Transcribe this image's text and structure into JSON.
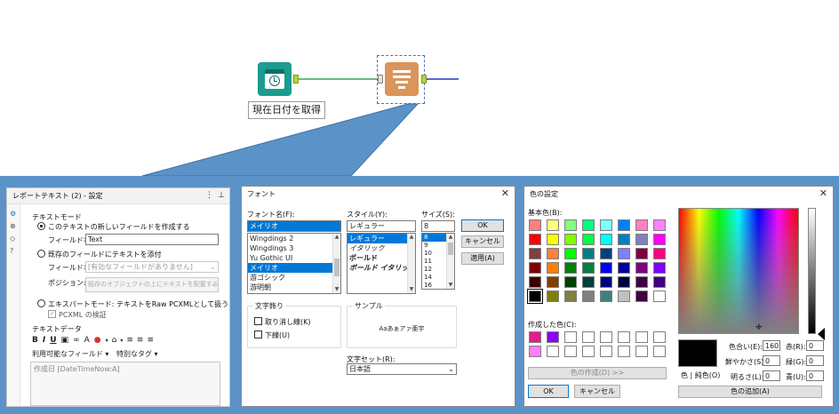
{
  "canvas": {
    "date_tool_label": "現在日付を取得"
  },
  "config": {
    "title": "レポートテキスト (2) - 設定",
    "text_mode_label": "テキストモード",
    "radio_new_field": "このテキストの新しいフィールドを作成する",
    "field_name_label": "フィールド名:",
    "field_name_value": "Text",
    "radio_append": "既存のフィールドにテキストを添付",
    "field_name_label2": "フィールド名:",
    "field_name_placeholder": "[有効なフィールドがありません]",
    "position_label": "ポジション:",
    "position_value": "既存のオブジェクトの上にテキストを配置する",
    "radio_expert": "エキスパートモード: テキストをRaw PCXMLとして扱う",
    "pcxml_validate": "PCXML の検証",
    "text_data_label": "テキストデータ",
    "available_fields": "利用可能なフィールド",
    "special_tags": "特別なタグ",
    "text_content": "作成日 [DateTimeNow:A]"
  },
  "font_dialog": {
    "title": "フォント",
    "font_name_label": "フォント名(F):",
    "font_name_value": "メイリオ",
    "font_list": [
      "Wingdings 2",
      "Wingdings 3",
      "Yu Gothic UI",
      "メイリオ",
      "游ゴシック",
      "游明朝"
    ],
    "style_label": "スタイル(Y):",
    "style_value": "レギュラー",
    "style_list": [
      "レギュラー",
      "イタリック",
      "ボールド",
      "ボールド イタリック"
    ],
    "size_label": "サイズ(S):",
    "size_value": "8",
    "size_list": [
      "8",
      "9",
      "10",
      "11",
      "12",
      "14",
      "16"
    ],
    "ok": "OK",
    "cancel": "キャンセル",
    "apply": "適用(A)",
    "effects_label": "文字飾り",
    "strikeout": "取り消し線(K)",
    "underline": "下線(U)",
    "sample_label": "サンプル",
    "sample_text": "Aaあぁアァ亜宇",
    "charset_label": "文字セット(R):",
    "charset_value": "日本語"
  },
  "color_dialog": {
    "title": "色の設定",
    "basic_colors_label": "基本色(B):",
    "basic_colors": [
      [
        "#ff8080",
        "#ffff80",
        "#80ff80",
        "#00ff80",
        "#80ffff",
        "#0080ff",
        "#ff80c0",
        "#ff80ff"
      ],
      [
        "#ff0000",
        "#ffff00",
        "#80ff00",
        "#00ff40",
        "#00ffff",
        "#0080c0",
        "#8080c0",
        "#ff00ff"
      ],
      [
        "#804040",
        "#ff8040",
        "#00ff00",
        "#008080",
        "#004080",
        "#8080ff",
        "#800040",
        "#ff0080"
      ],
      [
        "#800000",
        "#ff8000",
        "#008000",
        "#008040",
        "#0000ff",
        "#0000a0",
        "#800080",
        "#8000ff"
      ],
      [
        "#400000",
        "#804000",
        "#004000",
        "#004040",
        "#000080",
        "#000040",
        "#400040",
        "#400080"
      ],
      [
        "#000000",
        "#808000",
        "#808040",
        "#808080",
        "#408080",
        "#c0c0c0",
        "#400040",
        "#ffffff"
      ]
    ],
    "custom_colors_label": "作成した色(C):",
    "custom_colors": [
      [
        "#e8198b",
        "#8b00ff",
        "",
        "",
        "",
        "",
        "",
        ""
      ],
      [
        "#ff80ff",
        "",
        "",
        "",
        "",
        "",
        "",
        ""
      ]
    ],
    "define_custom": "色の作成(D) >>",
    "ok": "OK",
    "cancel": "キャンセル",
    "color_solid_label": "色 | 純色(O)",
    "hue_label": "色合い(E):",
    "hue_value": "160",
    "sat_label": "鮮やかさ(S):",
    "sat_value": "0",
    "lum_label": "明るさ(L):",
    "lum_value": "0",
    "red_label": "赤(R):",
    "red_value": "0",
    "green_label": "緑(G):",
    "green_value": "0",
    "blue_label": "青(U):",
    "blue_value": "0",
    "add_custom": "色の追加(A)"
  }
}
